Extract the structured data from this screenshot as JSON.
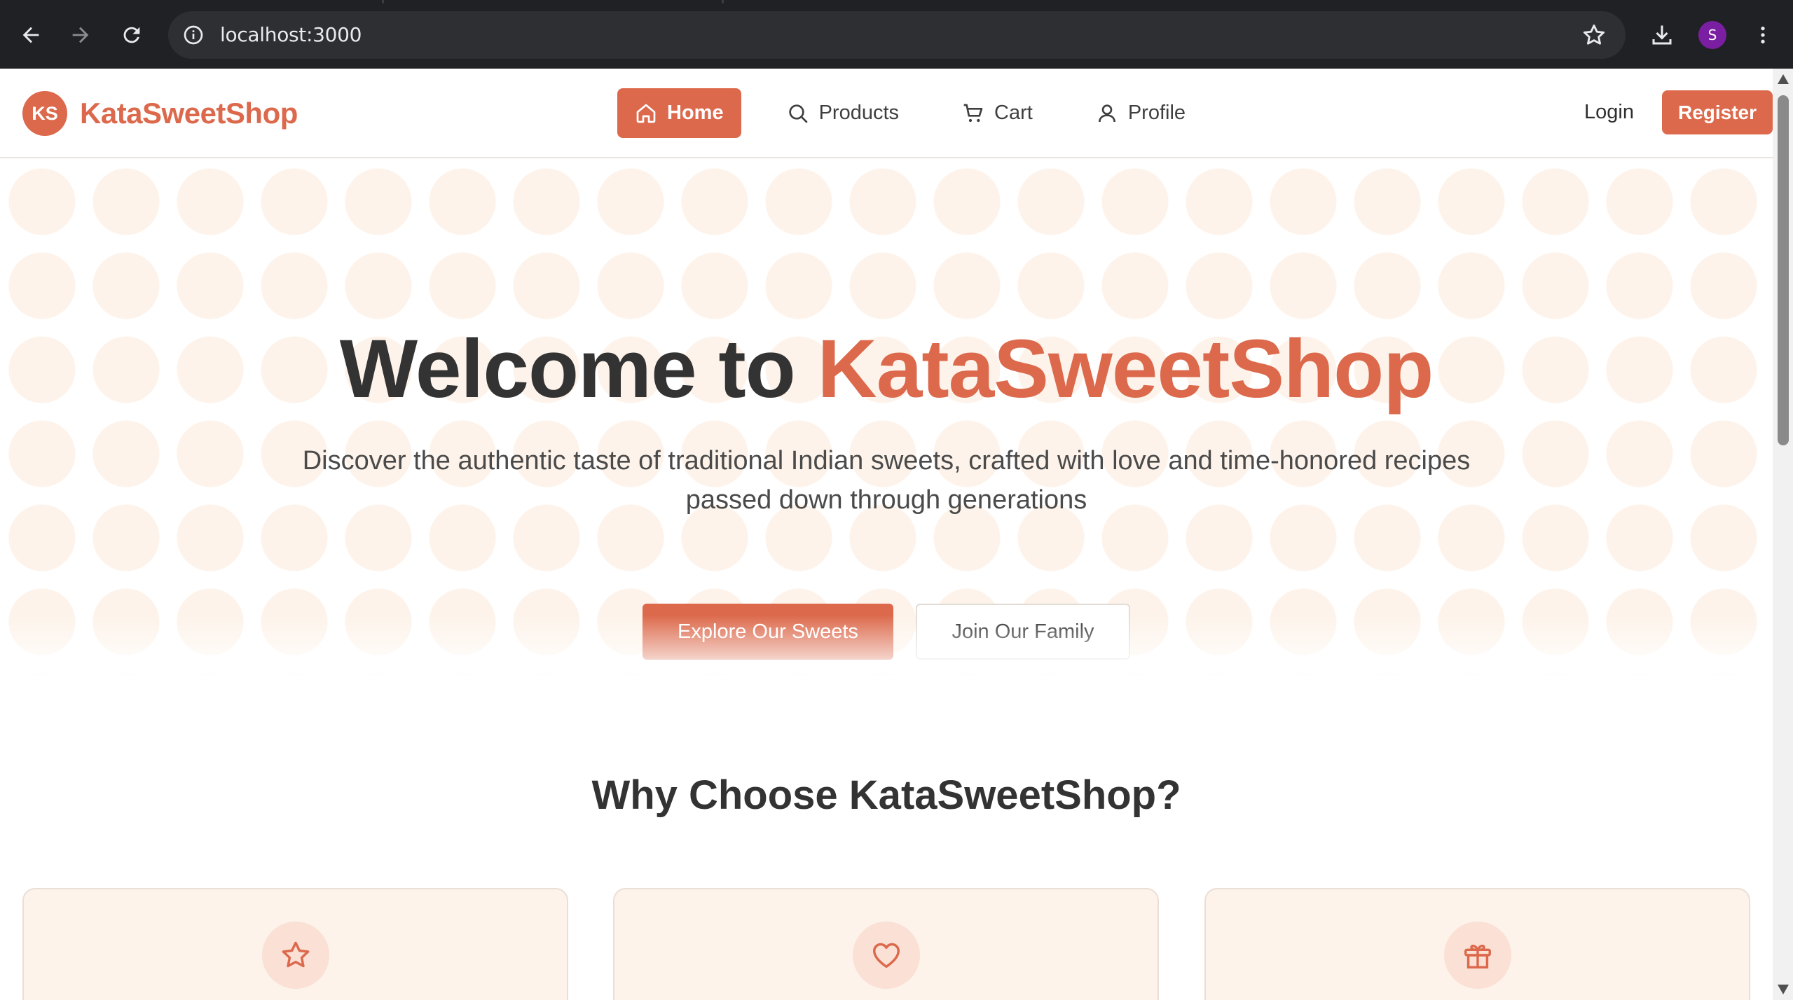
{
  "browser": {
    "url": "localhost:3000",
    "profile_initial": "S",
    "icons": [
      "back-arrow-icon",
      "forward-arrow-icon",
      "reload-icon",
      "info-icon",
      "star-icon",
      "download-icon",
      "more-vert-icon"
    ]
  },
  "header": {
    "brand_badge": "KS",
    "brand_name": "KataSweetShop",
    "nav": [
      {
        "label": "Home",
        "icon": "home-icon",
        "active": true
      },
      {
        "label": "Products",
        "icon": "search-icon",
        "active": false
      },
      {
        "label": "Cart",
        "icon": "cart-icon",
        "active": false
      },
      {
        "label": "Profile",
        "icon": "user-icon",
        "active": false
      }
    ],
    "login_label": "Login",
    "register_label": "Register"
  },
  "hero": {
    "title_prefix": "Welcome to",
    "title_accent": "KataSweetShop",
    "subtitle": "Discover the authentic taste of traditional Indian sweets, crafted with love and time-honored recipes passed down through generations",
    "primary_cta": "Explore Our Sweets",
    "secondary_cta": "Join Our Family"
  },
  "features": {
    "title": "Why Choose KataSweetShop?",
    "cards": [
      {
        "icon": "star-icon"
      },
      {
        "icon": "heart-icon"
      },
      {
        "icon": "gift-icon"
      }
    ]
  },
  "colors": {
    "accent": "#dc694c",
    "hero_pattern": "#fdf3ea",
    "card_background": "#fdf3ea",
    "text_dark": "#333333"
  }
}
